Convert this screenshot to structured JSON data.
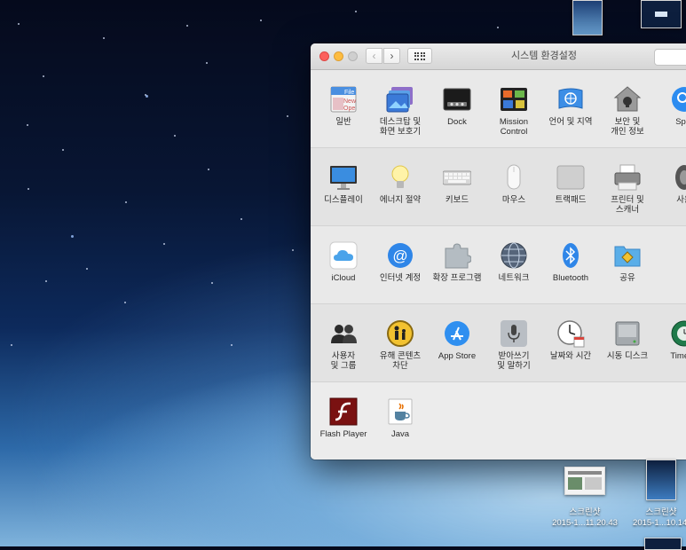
{
  "window": {
    "title": "시스템 환경설정",
    "search_placeholder": ""
  },
  "sections": [
    [
      {
        "label": "일반",
        "icon": "general-icon"
      },
      {
        "label": "데스크탑 및\n화면 보호기",
        "icon": "desktop-screensaver-icon"
      },
      {
        "label": "Dock",
        "icon": "dock-icon"
      },
      {
        "label": "Mission\nControl",
        "icon": "mission-control-icon"
      },
      {
        "label": "언어 및 지역",
        "icon": "language-region-icon"
      },
      {
        "label": "보안 및\n개인 정보",
        "icon": "security-icon"
      },
      {
        "label": "Spot",
        "icon": "spotlight-icon"
      }
    ],
    [
      {
        "label": "디스플레이",
        "icon": "displays-icon"
      },
      {
        "label": "에너지 절약",
        "icon": "energy-saver-icon"
      },
      {
        "label": "키보드",
        "icon": "keyboard-icon"
      },
      {
        "label": "마우스",
        "icon": "mouse-icon"
      },
      {
        "label": "트랙패드",
        "icon": "trackpad-icon"
      },
      {
        "label": "프린터 및\n스캐너",
        "icon": "printer-icon"
      },
      {
        "label": "사운",
        "icon": "sound-icon"
      }
    ],
    [
      {
        "label": "iCloud",
        "icon": "icloud-icon"
      },
      {
        "label": "인터넷 계정",
        "icon": "internet-accounts-icon"
      },
      {
        "label": "확장 프로그램",
        "icon": "extensions-icon"
      },
      {
        "label": "네트워크",
        "icon": "network-icon"
      },
      {
        "label": "Bluetooth",
        "icon": "bluetooth-icon"
      },
      {
        "label": "공유",
        "icon": "sharing-icon"
      }
    ],
    [
      {
        "label": "사용자\n및 그룹",
        "icon": "users-groups-icon"
      },
      {
        "label": "유해 콘텐츠\n차단",
        "icon": "parental-controls-icon"
      },
      {
        "label": "App Store",
        "icon": "app-store-icon"
      },
      {
        "label": "받아쓰기\n및 말하기",
        "icon": "dictation-icon"
      },
      {
        "label": "날짜와 시간",
        "icon": "date-time-icon"
      },
      {
        "label": "시동 디스크",
        "icon": "startup-disk-icon"
      },
      {
        "label": "Time M",
        "icon": "time-machine-icon"
      }
    ],
    [
      {
        "label": "Flash Player",
        "icon": "flash-player-icon"
      },
      {
        "label": "Java",
        "icon": "java-icon"
      }
    ]
  ],
  "desktop": {
    "icon1_label_line1": "스크린샷",
    "icon1_label_line2": "2015-1...11.20.43",
    "icon2_label_line1": "스크린샷",
    "icon2_label_line2": "2015-1...10.14."
  },
  "colors": {
    "accent_blue": "#1a82e2",
    "close": "#fc605c",
    "minimize": "#fdbc40"
  }
}
